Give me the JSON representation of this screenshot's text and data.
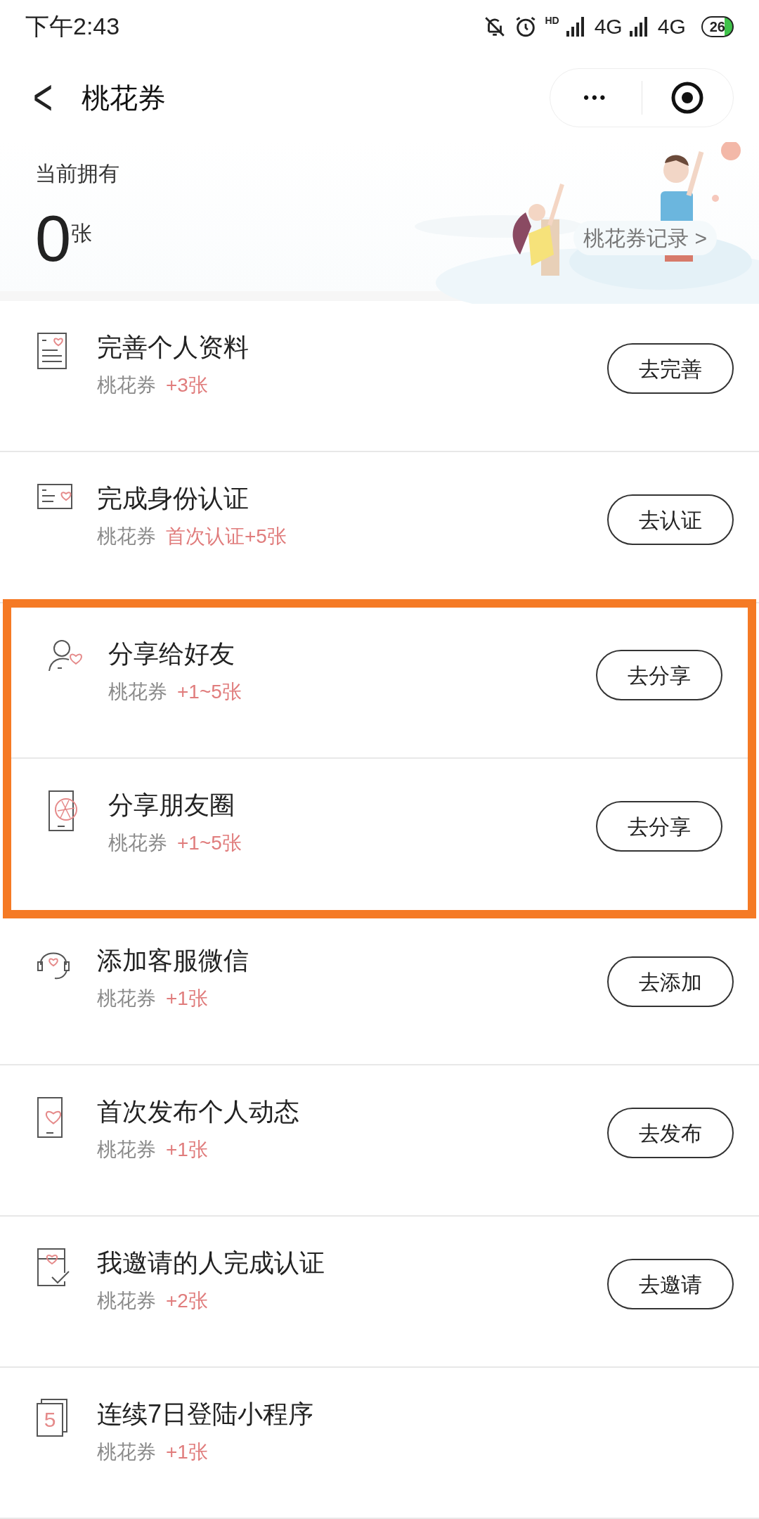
{
  "status_bar": {
    "time": "下午2:43",
    "hd": "HD",
    "network_1": "4G",
    "network_2": "4G",
    "battery": "26"
  },
  "header": {
    "back": "<",
    "title": "桃花券",
    "more": "•••"
  },
  "summary": {
    "label": "当前拥有",
    "count": "0",
    "unit": "张",
    "record_link": "桃花券记录 >"
  },
  "groups": [
    {
      "highlighted": false,
      "tasks": [
        {
          "kind": "profile",
          "title": "完善个人资料",
          "reward_label": "桃花券",
          "reward": "+3张",
          "button": "去完善"
        },
        {
          "kind": "id-card",
          "title": "完成身份认证",
          "reward_label": "桃花券",
          "reward": "首次认证+5张",
          "button": "去认证"
        }
      ]
    },
    {
      "highlighted": true,
      "tasks": [
        {
          "kind": "friend",
          "title": "分享给好友",
          "reward_label": "桃花券",
          "reward": "+1~5张",
          "button": "去分享"
        },
        {
          "kind": "moments",
          "title": "分享朋友圈",
          "reward_label": "桃花券",
          "reward": "+1~5张",
          "button": "去分享"
        }
      ]
    },
    {
      "highlighted": false,
      "tasks": [
        {
          "kind": "headset",
          "title": "添加客服微信",
          "reward_label": "桃花券",
          "reward": "+1张",
          "button": "去添加"
        },
        {
          "kind": "phone",
          "title": "首次发布个人动态",
          "reward_label": "桃花券",
          "reward": "+1张",
          "button": "去发布"
        },
        {
          "kind": "invite",
          "title": "我邀请的人完成认证",
          "reward_label": "桃花券",
          "reward": "+2张",
          "button": "去邀请"
        },
        {
          "kind": "calendar",
          "day": "5",
          "title": "连续7日登陆小程序",
          "reward_label": "桃花券",
          "reward": "+1张"
        }
      ]
    }
  ]
}
